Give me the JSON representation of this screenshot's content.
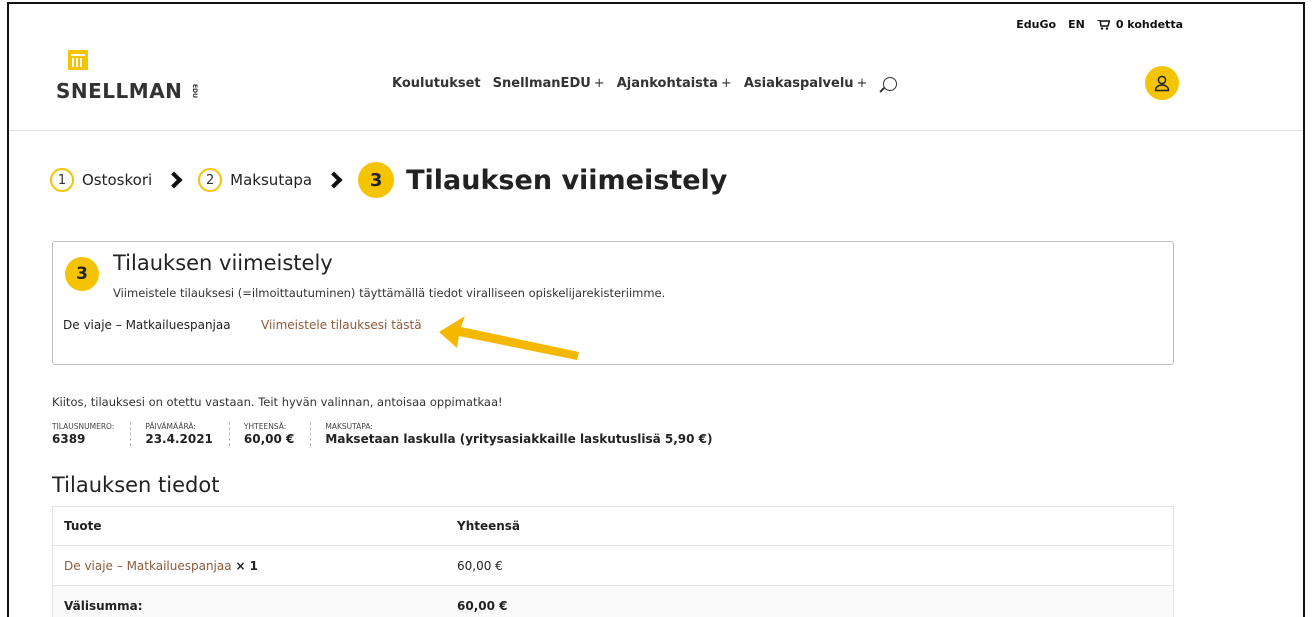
{
  "topbar": {
    "edugo": "EduGo",
    "lang": "EN",
    "cart": "0 kohdetta"
  },
  "logo": {
    "text": "SNELLMAN",
    "suffix": "EDU"
  },
  "nav": {
    "items": [
      {
        "label": "Koulutukset",
        "plus": ""
      },
      {
        "label": "SnellmanEDU",
        "plus": "+"
      },
      {
        "label": "Ajankohtaista",
        "plus": "+"
      },
      {
        "label": "Asiakaspalvelu",
        "plus": "+"
      }
    ]
  },
  "steps": [
    {
      "num": "1",
      "label": "Ostoskori"
    },
    {
      "num": "2",
      "label": "Maksutapa"
    },
    {
      "num": "3",
      "label": "Tilauksen viimeistely"
    }
  ],
  "notice": {
    "num": "3",
    "title": "Tilauksen viimeistely",
    "desc": "Viimeistele tilauksesi (=ilmoittautuminen) täyttämällä tiedot viralliseen opiskelijarekisteriimme.",
    "product": "De viaje – Matkailuespanjaa",
    "link": "Viimeistele tilauksesi tästä"
  },
  "thanks": "Kiitos, tilauksesi on otettu vastaan. Teit hyvän valinnan, antoisaa oppimatkaa!",
  "meta": [
    {
      "label": "Tilausnumero:",
      "value": "6389"
    },
    {
      "label": "Päivämäärä:",
      "value": "23.4.2021"
    },
    {
      "label": "Yhteensä:",
      "value": "60,00 €"
    },
    {
      "label": "Maksutapa:",
      "value": "Maksetaan laskulla (yritysasiakkaille laskutuslisä 5,90 €)"
    }
  ],
  "details": {
    "title": "Tilauksen tiedot",
    "headers": [
      "Tuote",
      "Yhteensä"
    ],
    "product_name": "De viaje – Matkailuespanjaa",
    "product_qty": "× 1",
    "product_total": "60,00 €",
    "subtotal_label": "Välisumma:",
    "subtotal_value": "60,00 €"
  },
  "colors": {
    "accent": "#f5c400",
    "link": "#8c5a3c",
    "arrow": "#f5b800"
  }
}
